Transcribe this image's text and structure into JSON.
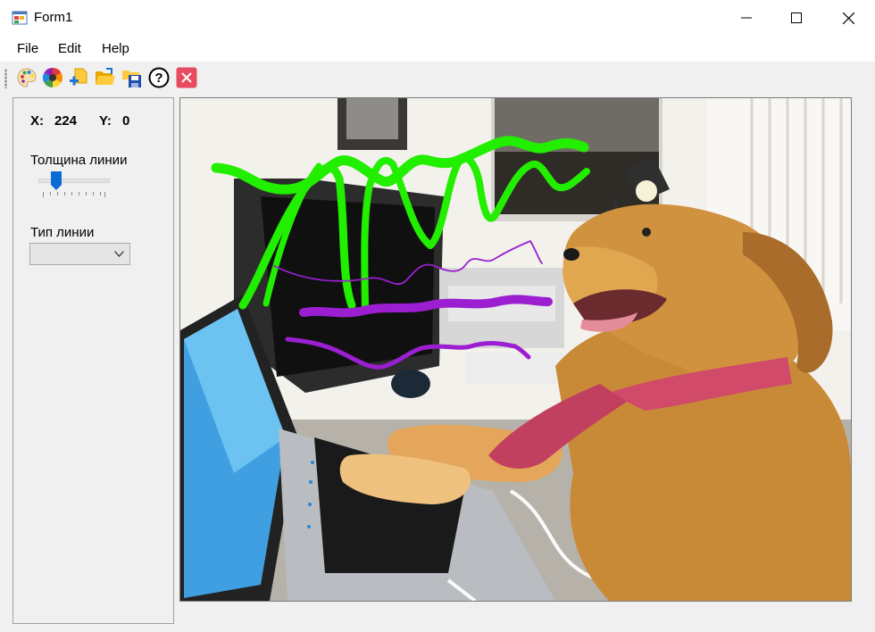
{
  "window": {
    "title": "Form1",
    "controls": [
      "minimize-icon",
      "maximize-icon",
      "close-icon"
    ]
  },
  "menu": {
    "items": [
      {
        "label": "File"
      },
      {
        "label": "Edit"
      },
      {
        "label": "Help"
      }
    ]
  },
  "toolbar": {
    "tools": [
      {
        "icon": "palette-icon"
      },
      {
        "icon": "color-wheel-icon"
      },
      {
        "icon": "new-file-icon"
      },
      {
        "icon": "open-folder-icon"
      },
      {
        "icon": "save-icon"
      },
      {
        "icon": "help-icon"
      },
      {
        "icon": "exit-icon"
      }
    ]
  },
  "panel": {
    "x_label": "X:",
    "x_value": "224",
    "y_label": "Y:",
    "y_value": "0",
    "thickness_label": "Толщина линии",
    "thickness_level": 0.25,
    "line_type_label": "Тип линии",
    "line_type_value": ""
  },
  "canvas": {
    "content": "photo-dog-at-laptop",
    "stroke_colors": {
      "green": "#22ee00",
      "purple": "#9b1fd0",
      "thin_purple": "#9a1fd6"
    }
  },
  "colors": {
    "window_bg": "#f0f0f0",
    "titlebar_bg": "#ffffff",
    "accent": "#0a6cd6",
    "exit_red": "#e84a5f"
  }
}
